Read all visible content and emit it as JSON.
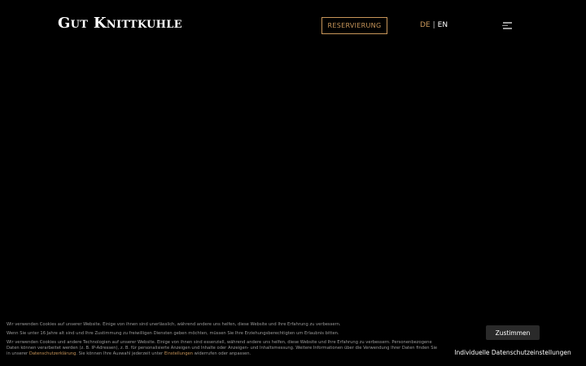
{
  "header": {
    "logo_text": "Gut Knittkuhle",
    "reserve_label": "RESERVIERUNG",
    "lang_active": "DE",
    "lang_separator": "|",
    "lang_other": "EN",
    "menu_icon": "hamburger-menu-icon"
  },
  "cookie_banner": {
    "text_1": "Wir verwenden Cookies auf unserer Website. Einige von ihnen sind unerlässlich, während andere uns helfen, diese Website und Ihre Erfahrung zu verbessern.",
    "text_2": "Wenn Sie unter 16 Jahre alt sind und Ihre Zustimmung zu freiwilligen Diensten geben möchten, müssen Sie Ihre Erziehungsberechtigten um Erlaubnis bitten.",
    "text_3_part1": "Wir verwenden Cookies und andere Technologien auf unserer Website. Einige von ihnen sind essenziell, während andere uns helfen, diese Website und Ihre Erfahrung zu verbessern. Personenbezogene Daten können verarbeitet werden (z. B. IP-Adressen), z. B. für personalisierte Anzeigen und Inhalte oder Anzeigen- und Inhaltsmessung. Weitere Informationen über die Verwendung Ihrer Daten finden Sie in unserer ",
    "privacy_link": "Datenschutzerklärung",
    "text_3_part2": ". Sie können Ihre Auswahl jederzeit unter ",
    "settings_link": "Einstellungen",
    "text_3_part3": " widerrufen oder anpassen.",
    "accept_label": "Zustimmen",
    "settings_label": "Individuelle Datenschutzeinstellungen"
  },
  "colors": {
    "background": "#000000",
    "accent": "#c8965a",
    "text_muted": "#9a9a9a"
  }
}
